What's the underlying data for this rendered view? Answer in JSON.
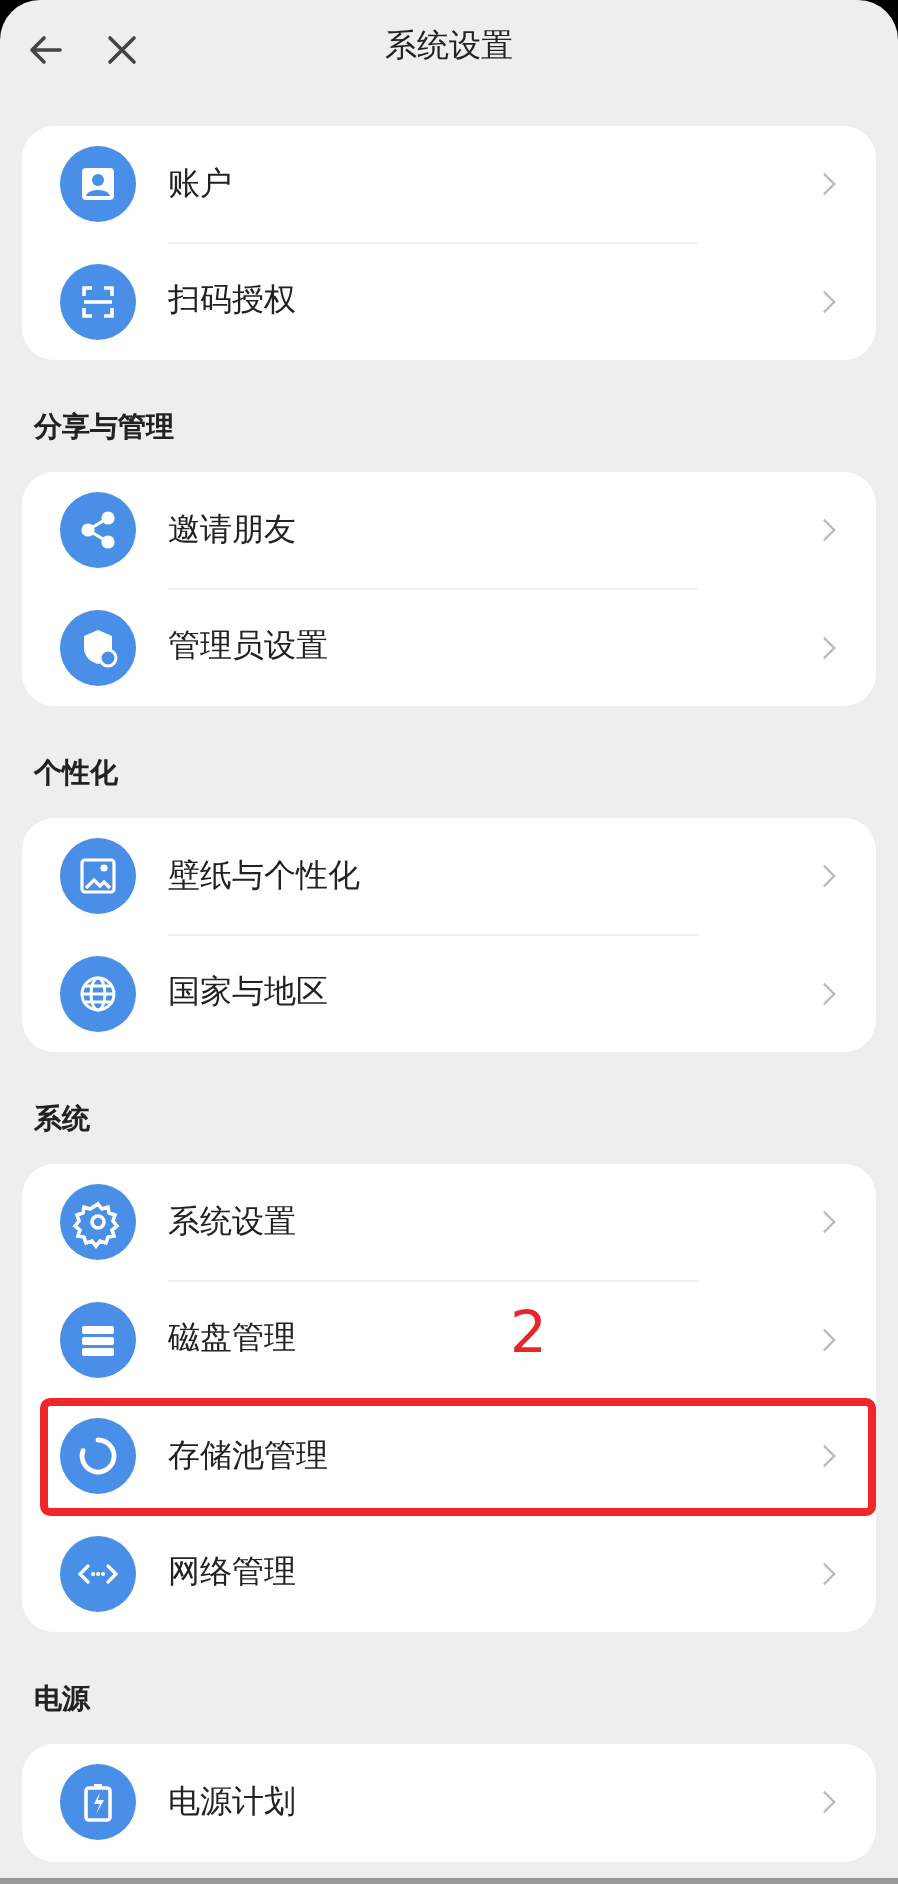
{
  "header": {
    "title": "系统设置"
  },
  "groups": [
    {
      "items": [
        {
          "label": "账户",
          "highlighted": false
        },
        {
          "label": "扫码授权",
          "highlighted": false
        }
      ]
    },
    {
      "heading": "分享与管理",
      "items": [
        {
          "label": "邀请朋友",
          "highlighted": false
        },
        {
          "label": "管理员设置",
          "highlighted": false
        }
      ]
    },
    {
      "heading": "个性化",
      "items": [
        {
          "label": "壁纸与个性化",
          "highlighted": false
        },
        {
          "label": "国家与地区",
          "highlighted": false
        }
      ]
    },
    {
      "heading": "系统",
      "items": [
        {
          "label": "系统设置",
          "highlighted": false
        },
        {
          "label": "磁盘管理",
          "highlighted": false
        },
        {
          "label": "存储池管理",
          "highlighted": true
        },
        {
          "label": "网络管理",
          "highlighted": false
        }
      ]
    },
    {
      "heading": "电源",
      "items": [
        {
          "label": "电源计划",
          "highlighted": false
        }
      ]
    }
  ],
  "annotation": {
    "label": "2"
  }
}
